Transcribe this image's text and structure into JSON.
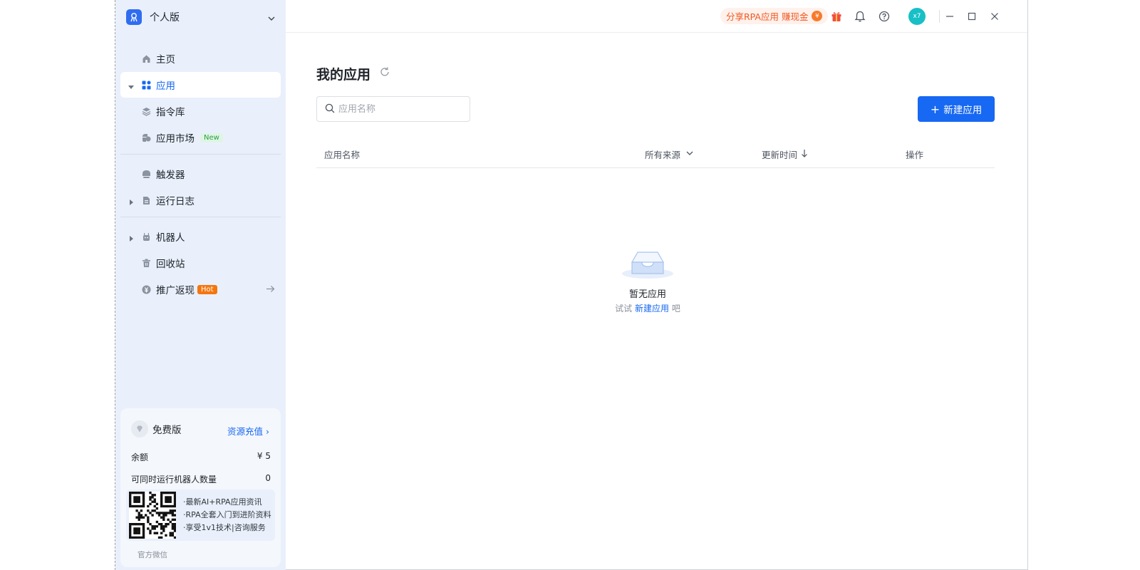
{
  "workspace": {
    "name": "个人版"
  },
  "nav": {
    "home": "主页",
    "apps": "应用",
    "commands": "指令库",
    "market": "应用市场",
    "market_badge": "New",
    "triggers": "触发器",
    "logs": "运行日志",
    "robots": "机器人",
    "recycle": "回收站",
    "referral": "推广返现",
    "referral_badge": "Hot"
  },
  "plan": {
    "name": "免费版",
    "recharge": "资源充值 ›",
    "balance_label": "余额",
    "balance_value": "¥ 5",
    "robots_label": "可同时运行机器人数量",
    "robots_value": "0",
    "promo_lines": [
      "·最新AI+RPA应用资讯",
      "·RPA全套入门到进阶资料",
      "·享受1v1技术|咨询服务"
    ],
    "qr_caption": "官方微信"
  },
  "topbar": {
    "share": "分享RPA应用 赚现金",
    "share_coin": "¥",
    "avatar": "x7"
  },
  "main": {
    "title": "我的应用",
    "search_placeholder": "应用名称",
    "new_button": "新建应用",
    "columns": {
      "name": "应用名称",
      "source": "所有来源",
      "updated": "更新时间",
      "actions": "操作"
    },
    "empty": {
      "title": "暂无应用",
      "hint_prefix": "试试 ",
      "hint_link": "新建应用",
      "hint_suffix": " 吧"
    }
  },
  "colors": {
    "accent": "#1768f2",
    "sidebar_bg": "#e9f0fc",
    "hot": "#f5760f",
    "new": "#2aa04a",
    "share": "#ef5a23"
  }
}
